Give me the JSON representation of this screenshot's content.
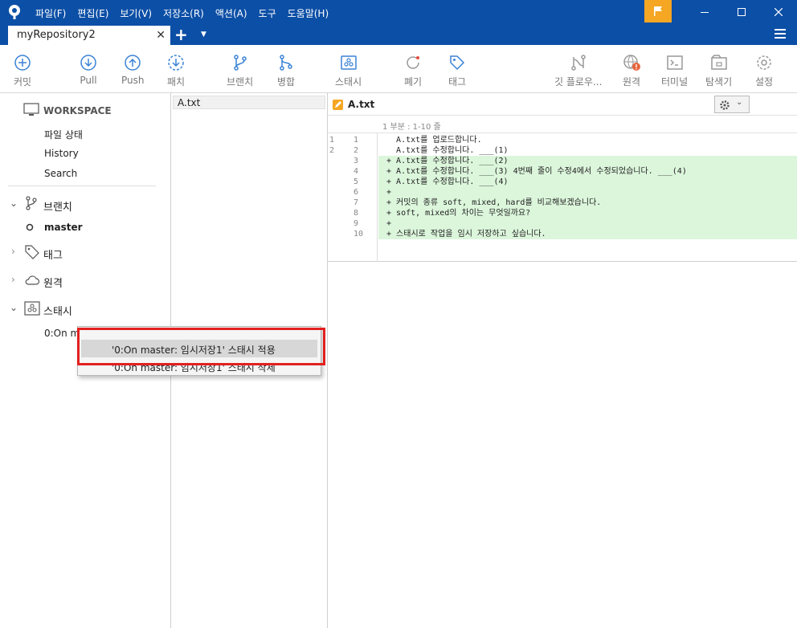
{
  "menu": [
    "파일(F)",
    "편집(E)",
    "보기(V)",
    "저장소(R)",
    "액션(A)",
    "도구",
    "도움말(H)"
  ],
  "tab": {
    "title": "myRepository2",
    "close": "✕"
  },
  "toolbar": {
    "commit": "커밋",
    "pull": "Pull",
    "push": "Push",
    "fetch": "패치",
    "branch": "브랜치",
    "merge": "병합",
    "stash": "스태시",
    "discard": "폐기",
    "tag": "태그",
    "gitflow": "깃 플로우...",
    "remote": "원격",
    "terminal": "터미널",
    "explorer": "탐색기",
    "settings": "설정"
  },
  "sidebar": {
    "workspace": "WORKSPACE",
    "file_status": "파일 상태",
    "history": "History",
    "search": "Search",
    "branches": "브랜치",
    "master": "master",
    "tags": "태그",
    "remotes": "원격",
    "stashes": "스태시",
    "stash_item": "0:On master: 임시저장1"
  },
  "files": {
    "header": "A.txt"
  },
  "diff": {
    "filename": "A.txt",
    "hunk": "1 부분 : 1-10 줄",
    "lines": [
      {
        "old": "1",
        "new": "1",
        "text": "   A.txt를 업로드합니다.",
        "type": "ctx"
      },
      {
        "old": "2",
        "new": "2",
        "text": "   A.txt를 수정합니다. ___(1)",
        "type": "ctx"
      },
      {
        "old": "",
        "new": "3",
        "text": " + A.txt를 수정합니다. ___(2)",
        "type": "add"
      },
      {
        "old": "",
        "new": "4",
        "text": " + A.txt를 수정합니다. ___(3) 4번째 줄이 수정4에서 수정되었습니다. ___(4)",
        "type": "add"
      },
      {
        "old": "",
        "new": "5",
        "text": " + A.txt를 수정합니다. ___(4)",
        "type": "add"
      },
      {
        "old": "",
        "new": "6",
        "text": " +",
        "type": "add"
      },
      {
        "old": "",
        "new": "7",
        "text": " + 커밋의 종류 soft, mixed, hard를 비교해보겠습니다.",
        "type": "add"
      },
      {
        "old": "",
        "new": "8",
        "text": " + soft, mixed의 차이는 무엇일까요?",
        "type": "add"
      },
      {
        "old": "",
        "new": "9",
        "text": " +",
        "type": "add"
      },
      {
        "old": "",
        "new": "10",
        "text": " + 스태시로 작업을 임시 저장하고 싶습니다.",
        "type": "add"
      }
    ]
  },
  "context_menu": {
    "apply": "'0:On master: 임시저장1' 스태시 적용",
    "delete": "'0:On master: 임시저장1' 스태시 삭제"
  },
  "colors": {
    "titlebar": "#0c4fa6",
    "flag": "#f5a623",
    "added_line": "#dcf6dc",
    "highlight_box": "#e32020"
  }
}
